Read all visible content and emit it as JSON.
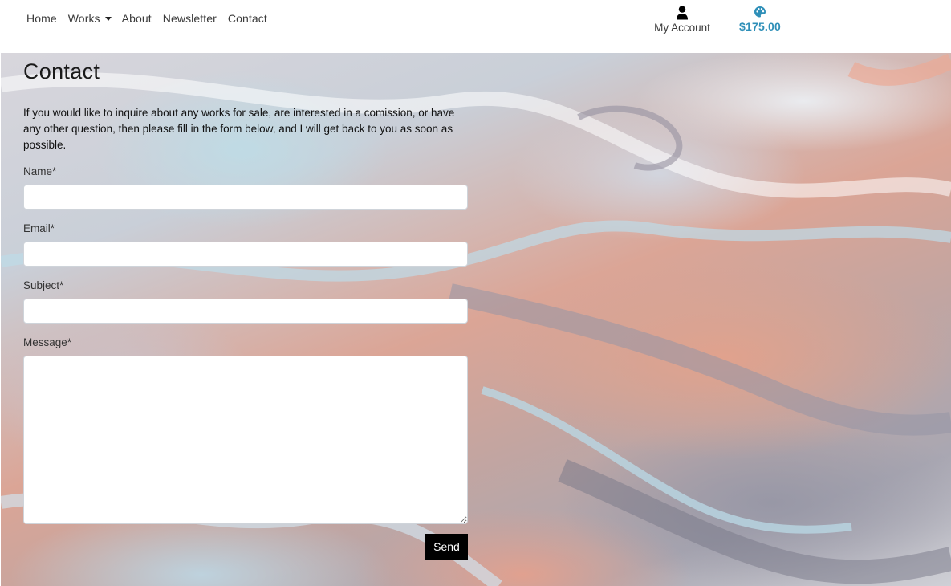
{
  "nav": {
    "links": [
      {
        "label": "Home"
      },
      {
        "label": "Works"
      },
      {
        "label": "About"
      },
      {
        "label": "Newsletter"
      },
      {
        "label": "Contact"
      }
    ],
    "account_label": "My Account",
    "account_icon": "user-icon",
    "cart_total": "$175.00",
    "cart_icon": "palette-icon"
  },
  "colors": {
    "accent": "#2e8fb8",
    "button_bg": "#000000",
    "button_text": "#ffffff"
  },
  "page": {
    "title": "Contact",
    "intro": "If you would like to inquire about any works for sale, are interested in a comission, or have any other question, then please fill in the form below, and I will get back to you as soon as possible."
  },
  "form": {
    "name_label": "Name*",
    "name_value": "",
    "email_label": "Email*",
    "email_value": "",
    "subject_label": "Subject*",
    "subject_value": "",
    "message_label": "Message*",
    "message_value": "",
    "send_label": "Send"
  }
}
